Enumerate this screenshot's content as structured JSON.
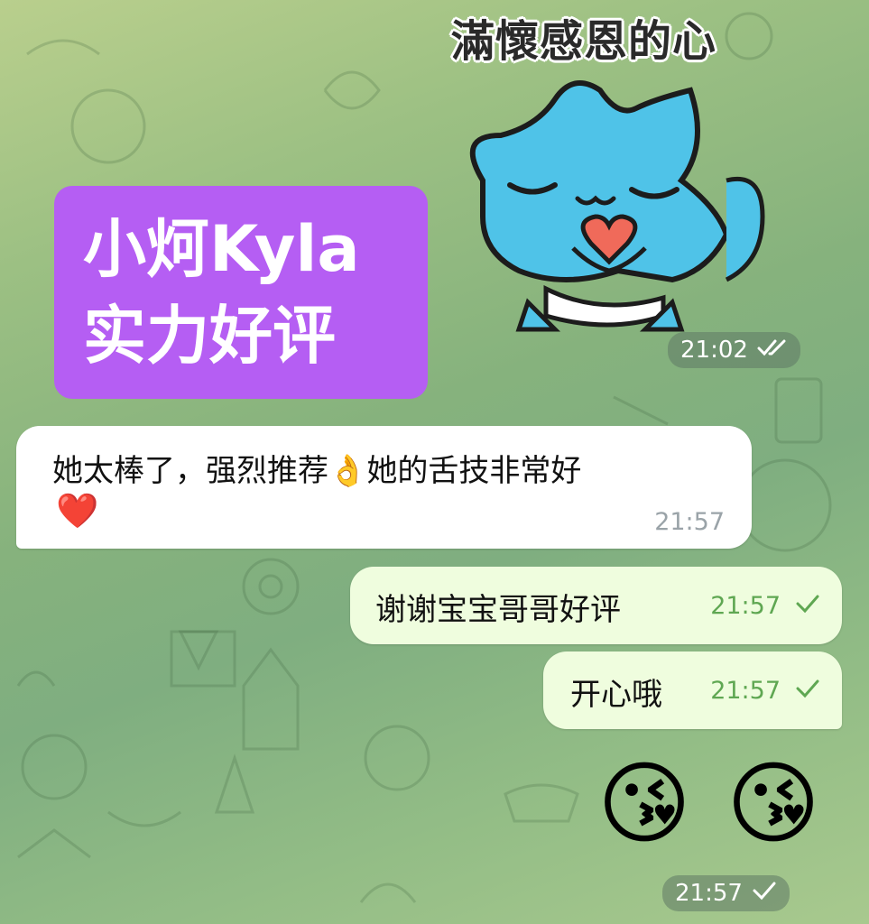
{
  "sticker": {
    "caption": "滿懷感恩的心",
    "time": "21:02",
    "status_icon": "double-check-icon"
  },
  "badge": {
    "line1": "小炣Kyla",
    "line2": "实力好评"
  },
  "messages": [
    {
      "direction": "incoming",
      "text": "她太棒了，强烈推荐👌她的舌技非常好",
      "emoji_line": "❤️",
      "time": "21:57"
    },
    {
      "direction": "outgoing",
      "text": "谢谢宝宝哥哥好评",
      "time": "21:57",
      "status_icon": "single-check-icon"
    },
    {
      "direction": "outgoing",
      "text": "开心哦",
      "time": "21:57",
      "status_icon": "single-check-icon"
    }
  ],
  "emoji_message": {
    "emojis": [
      "😘",
      "😘"
    ],
    "time": "21:57",
    "status_icon": "single-check-icon"
  },
  "colors": {
    "badge_bg": "#b55ef3",
    "incoming_bubble": "#ffffff",
    "outgoing_bubble": "#effdde",
    "outgoing_meta": "#5fa752",
    "sticker_cat": "#4fc3e8"
  }
}
